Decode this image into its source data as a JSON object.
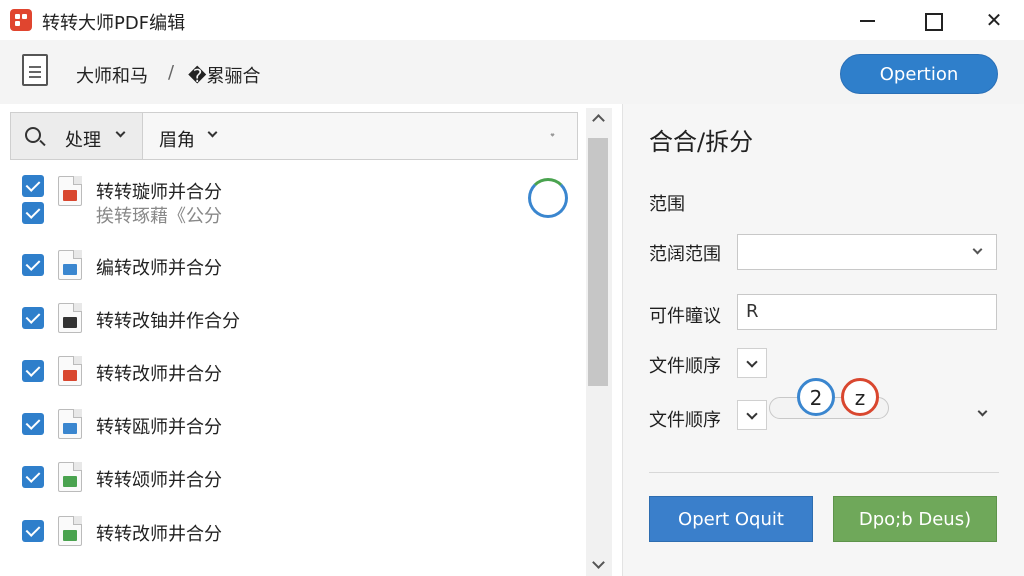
{
  "window": {
    "title": "转转大师PDF编辑",
    "minimize_icon": "minimize-icon",
    "maximize_icon": "maximize-icon",
    "close_icon": "close-icon"
  },
  "breadcrumb": {
    "item1": "大师和马",
    "separator": "/",
    "item2": "�累骊合"
  },
  "header": {
    "option_button": "Opertion"
  },
  "filter": {
    "label1": "处理",
    "label2": "眉角"
  },
  "files": [
    {
      "name": "转转璇师并合分",
      "icon": "pdf"
    },
    {
      "name": "挨转琢藉《公分",
      "icon": "ghost"
    },
    {
      "name": "编转改师并合分",
      "icon": "blue"
    },
    {
      "name": "转转改铀并作合分",
      "icon": "dark"
    },
    {
      "name": "转转改师井合分",
      "icon": "pdf"
    },
    {
      "name": "转转瓯师并合分",
      "icon": "blue"
    },
    {
      "name": "转转颂师并合分",
      "icon": "green"
    },
    {
      "name": "转转改师井合分",
      "icon": "green"
    }
  ],
  "right_panel": {
    "title": "合合/拆分",
    "range_heading": "范围",
    "range_label": "范阔范围",
    "range_value": "",
    "file_label": "可件瞳议",
    "file_value": "R",
    "order_label1": "文件顺序",
    "order_label2": "文件顺序",
    "badge1": "2",
    "badge2": "z",
    "button_blue": "Opert Oquit",
    "button_green": "Dpo;b Deus)"
  },
  "colors": {
    "accent_blue": "#2f7fcb",
    "accent_green": "#6fa85a",
    "pdf_red": "#d9472f"
  }
}
